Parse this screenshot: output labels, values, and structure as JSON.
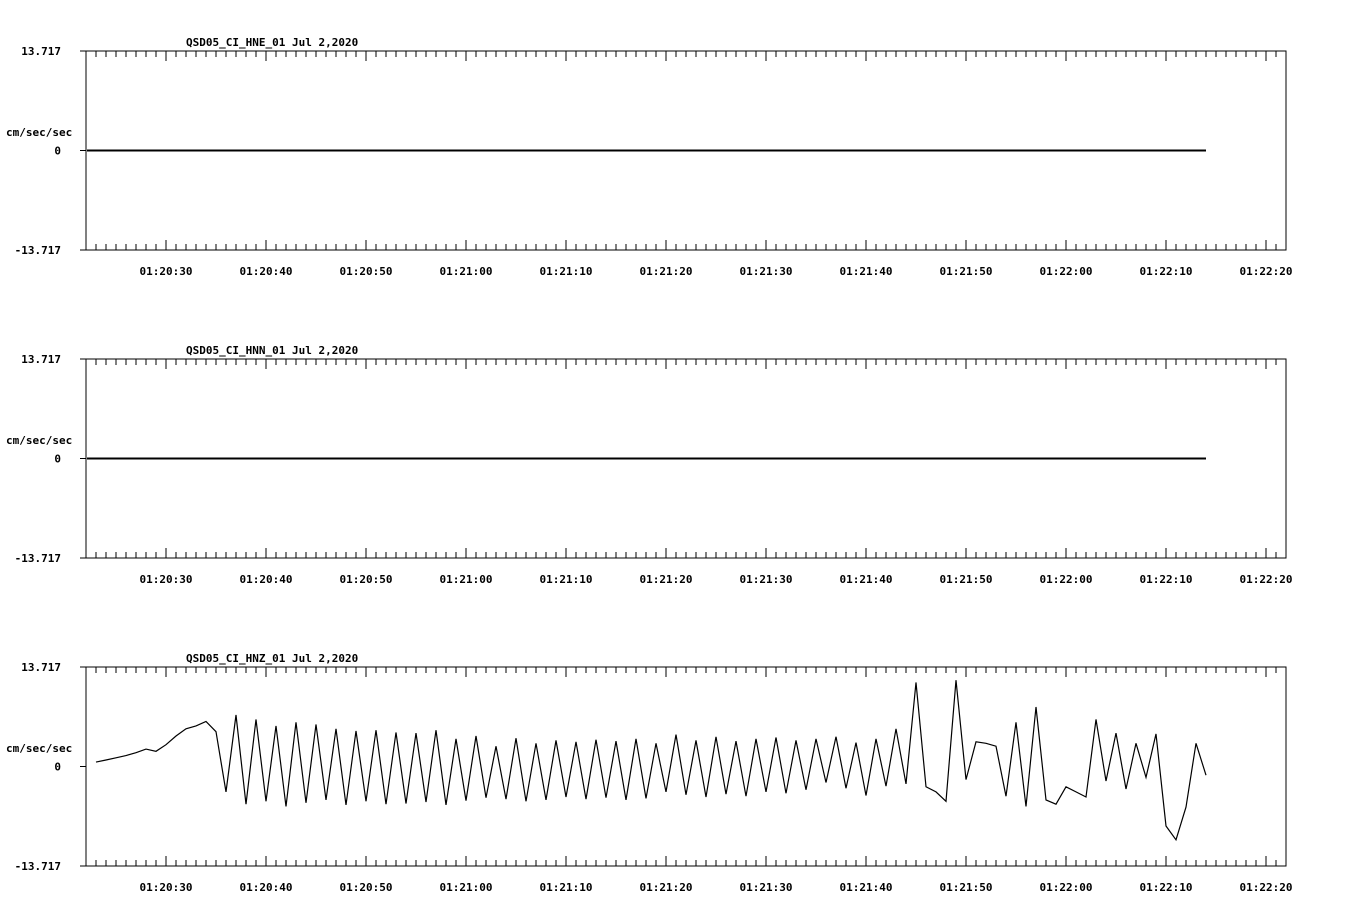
{
  "chart_data": [
    {
      "type": "line",
      "title": "QSD05_CI_HNE_01  Jul 2,2020",
      "ylabel": "cm/sec/sec",
      "ytick_labels": [
        "13.717",
        "0",
        "-13.717"
      ],
      "ylim": [
        -13.717,
        13.717
      ],
      "xtick_labels": [
        "01:20:30",
        "01:20:40",
        "01:20:50",
        "01:21:00",
        "01:21:10",
        "01:21:20",
        "01:21:30",
        "01:21:40",
        "01:21:50",
        "01:22:00",
        "01:22:10",
        "01:22:20"
      ],
      "grid": false,
      "series": [
        {
          "x": [
            -7.9,
            104
          ],
          "y": [
            0,
            0
          ]
        }
      ]
    },
    {
      "type": "line",
      "title": "QSD05_CI_HNN_01  Jul 2,2020",
      "ylabel": "cm/sec/sec",
      "ytick_labels": [
        "13.717",
        "0",
        "-13.717"
      ],
      "ylim": [
        -13.717,
        13.717
      ],
      "xtick_labels": [
        "01:20:30",
        "01:20:40",
        "01:20:50",
        "01:21:00",
        "01:21:10",
        "01:21:20",
        "01:21:30",
        "01:21:40",
        "01:21:50",
        "01:22:00",
        "01:22:10",
        "01:22:20"
      ],
      "grid": false,
      "series": [
        {
          "x": [
            -7.9,
            104
          ],
          "y": [
            0,
            0
          ]
        }
      ]
    },
    {
      "type": "line",
      "title": "QSD05_CI_HNZ_01  Jul 2,2020",
      "ylabel": "cm/sec/sec",
      "ytick_labels": [
        "13.717",
        "0",
        "-13.717"
      ],
      "ylim": [
        -13.717,
        13.717
      ],
      "xtick_labels": [
        "01:20:30",
        "01:20:40",
        "01:20:50",
        "01:21:00",
        "01:21:10",
        "01:21:20",
        "01:21:30",
        "01:21:40",
        "01:21:50",
        "01:22:00",
        "01:22:10",
        "01:22:20"
      ],
      "grid": false,
      "series": [
        {
          "x": [
            -7,
            -6,
            -5,
            -4,
            -3,
            -2,
            -1,
            0,
            1,
            2,
            3,
            4,
            5,
            6,
            7,
            8,
            9,
            10,
            11,
            12,
            13,
            14,
            15,
            16,
            17,
            18,
            19,
            20,
            21,
            22,
            23,
            24,
            25,
            26,
            27,
            28,
            29,
            30,
            31,
            32,
            33,
            34,
            35,
            36,
            37,
            38,
            39,
            40,
            41,
            42,
            43,
            44,
            45,
            46,
            47,
            48,
            49,
            50,
            51,
            52,
            53,
            54,
            55,
            56,
            57,
            58,
            59,
            60,
            61,
            62,
            63,
            64,
            65,
            66,
            67,
            68,
            69,
            70,
            71,
            72,
            73,
            74,
            75,
            76,
            77,
            78,
            79,
            80,
            81,
            82,
            83,
            84,
            85,
            86,
            87,
            88,
            89,
            90,
            91,
            92,
            93,
            94,
            95,
            96,
            97,
            98,
            99,
            100,
            101,
            102,
            103,
            104
          ],
          "y": [
            0.6,
            0.9,
            1.2,
            1.5,
            1.9,
            2.4,
            2.1,
            3.0,
            4.2,
            5.2,
            5.6,
            6.2,
            4.8,
            -3.5,
            7.1,
            -5.2,
            6.5,
            -4.8,
            5.6,
            -5.5,
            6.1,
            -5.0,
            5.8,
            -4.6,
            5.2,
            -5.3,
            4.9,
            -4.8,
            5.0,
            -5.2,
            4.7,
            -5.1,
            4.6,
            -4.9,
            5.0,
            -5.3,
            3.8,
            -4.7,
            4.2,
            -4.3,
            2.8,
            -4.5,
            3.9,
            -4.8,
            3.2,
            -4.6,
            3.6,
            -4.2,
            3.4,
            -4.5,
            3.7,
            -4.3,
            3.5,
            -4.6,
            3.8,
            -4.4,
            3.2,
            -3.5,
            4.4,
            -3.9,
            3.6,
            -4.2,
            4.1,
            -3.8,
            3.5,
            -4.1,
            3.8,
            -3.5,
            4.0,
            -3.7,
            3.6,
            -3.2,
            3.8,
            -2.2,
            4.1,
            -3.0,
            3.3,
            -4.0,
            3.8,
            -2.7,
            5.2,
            -2.4,
            11.6,
            -2.8,
            -3.5,
            -4.8,
            11.9,
            -1.8,
            3.4,
            3.2,
            2.8,
            -4.1,
            6.1,
            -5.5,
            8.2,
            -4.6,
            -5.2,
            -2.8,
            -3.5,
            -4.2,
            6.5,
            -2.0,
            4.6,
            -3.1,
            3.2,
            -1.5,
            4.5,
            -8.2,
            -10.1,
            -5.6,
            3.2,
            -1.2
          ]
        }
      ]
    }
  ]
}
